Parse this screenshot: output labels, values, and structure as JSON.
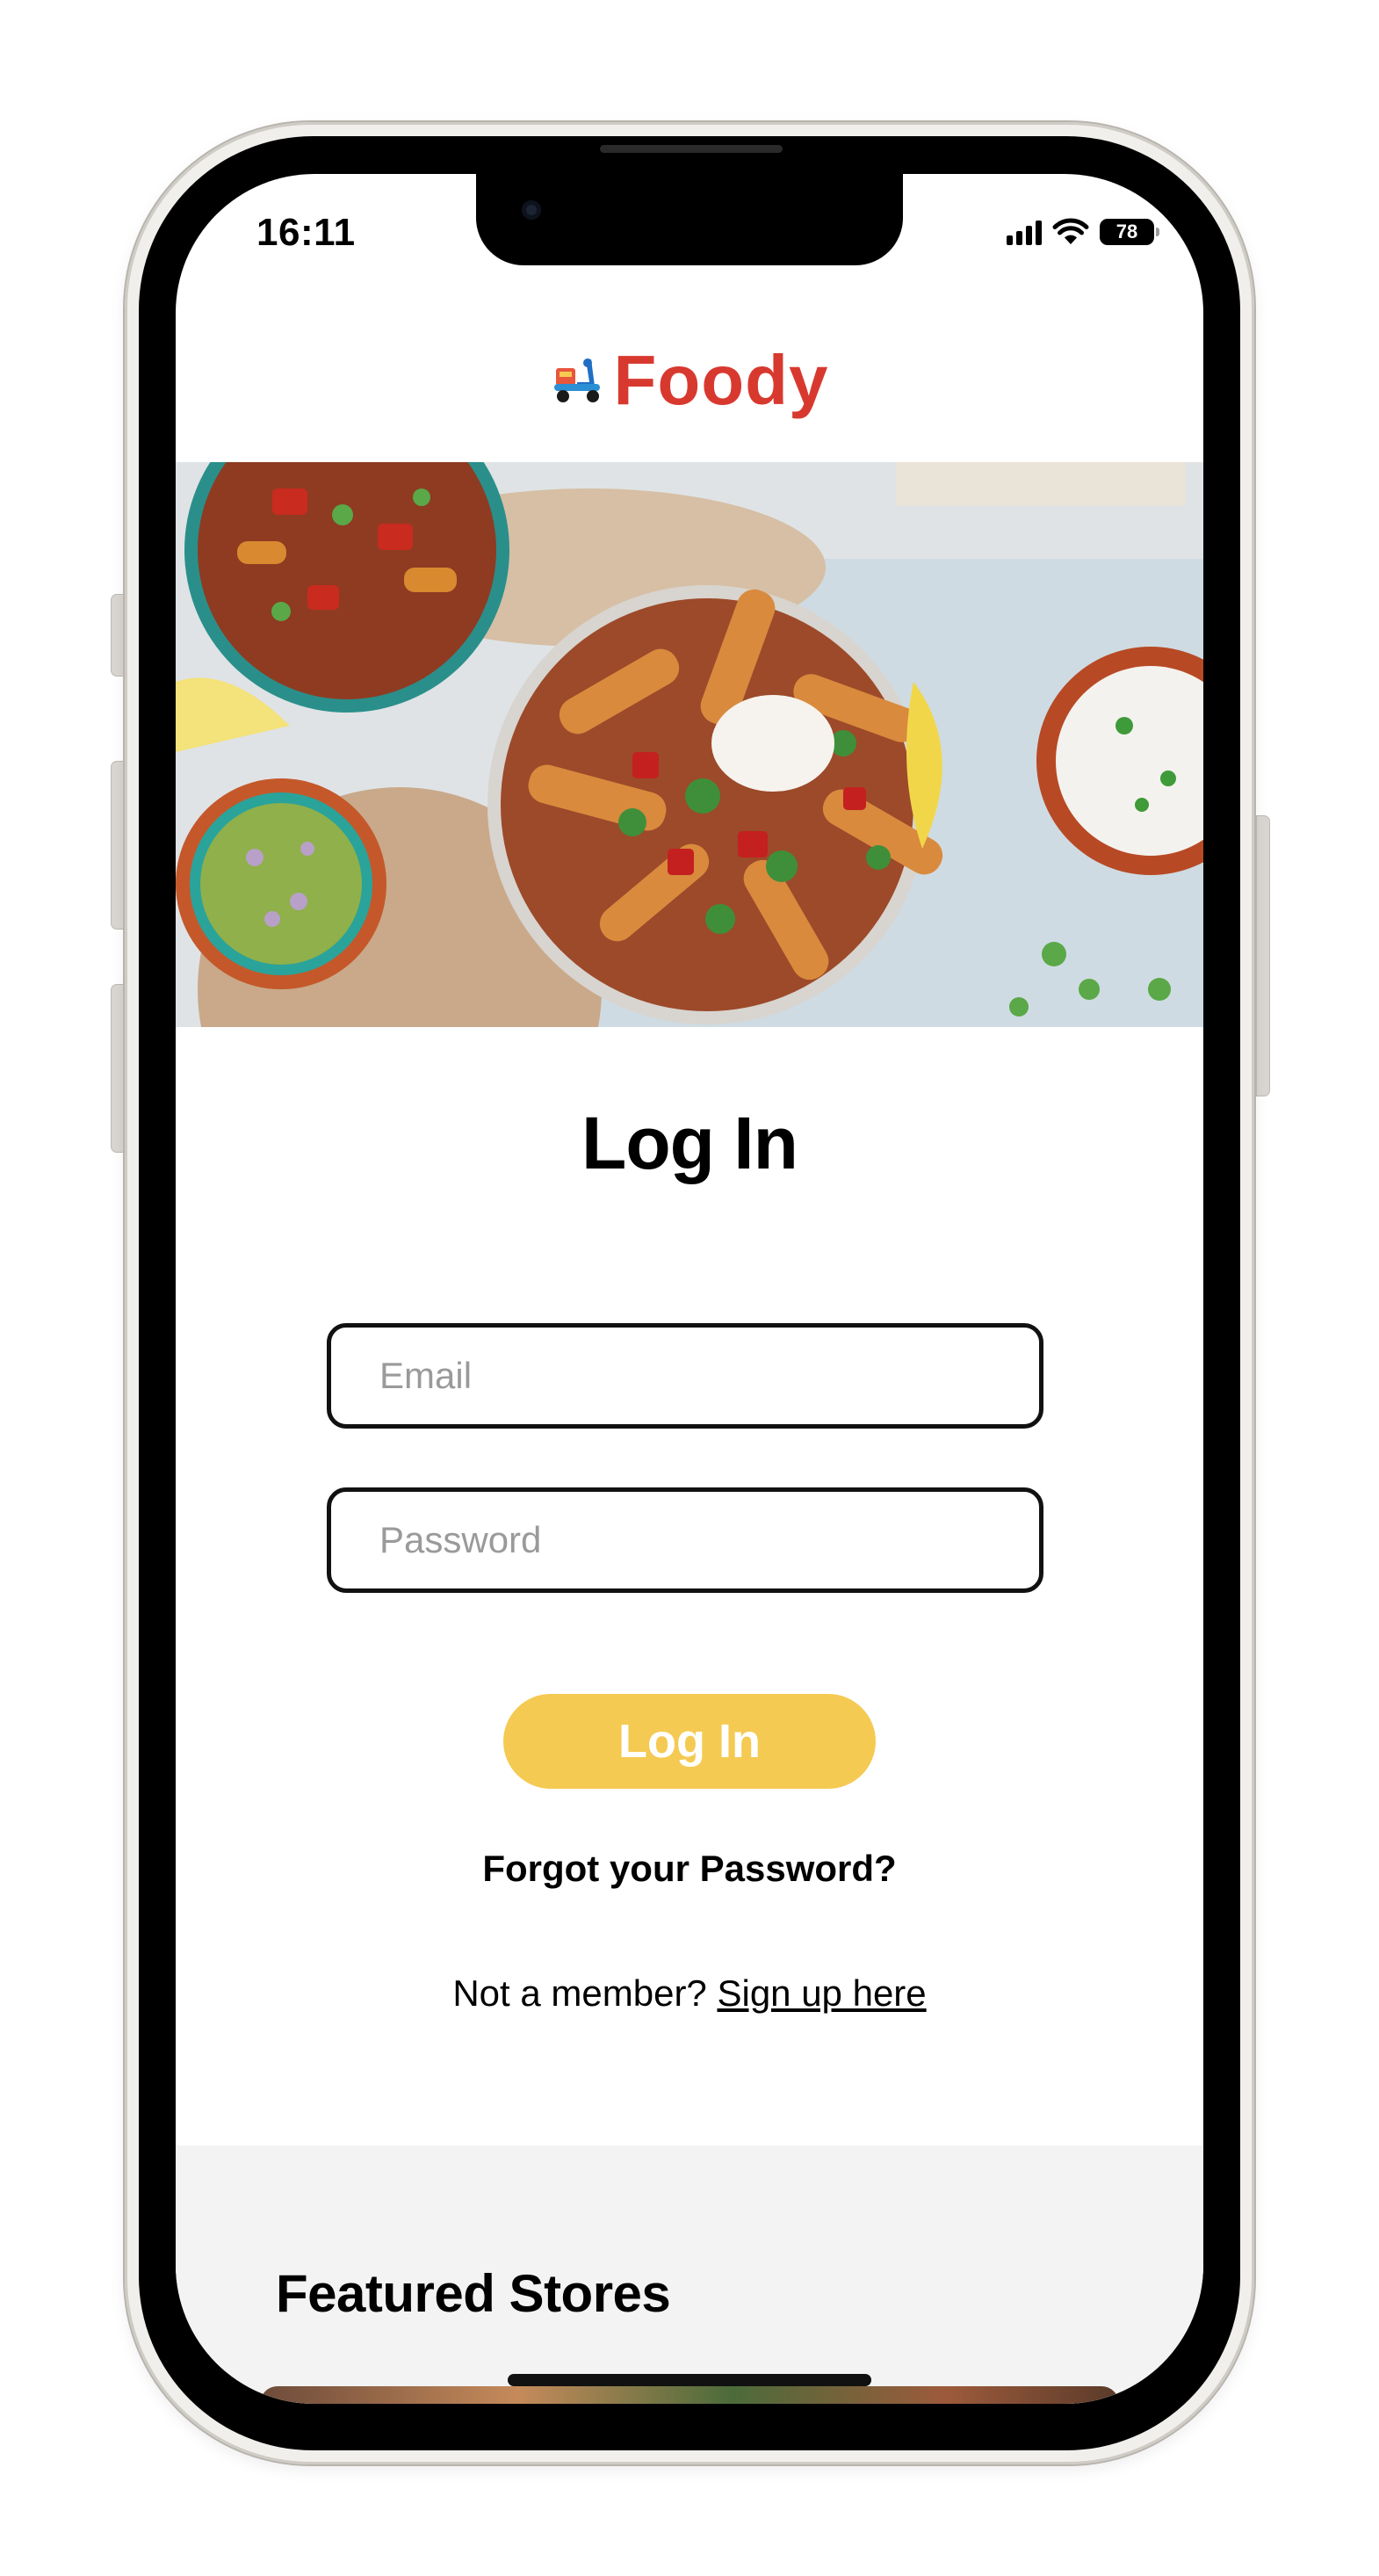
{
  "status_bar": {
    "time": "16:11",
    "battery_level": "78"
  },
  "header": {
    "brand": "Foody",
    "brand_color": "#d8392f"
  },
  "login": {
    "title": "Log In",
    "email_placeholder": "Email",
    "password_placeholder": "Password",
    "submit_label": "Log In",
    "submit_color": "#f5ca52",
    "forgot_password": "Forgot your Password?",
    "not_member_prefix": "Not a member?",
    "signup_link": "Sign up here"
  },
  "featured": {
    "title": "Featured Stores"
  },
  "icons": [
    "scooter-logo-icon",
    "signal-icon",
    "wifi-icon",
    "battery-icon"
  ]
}
